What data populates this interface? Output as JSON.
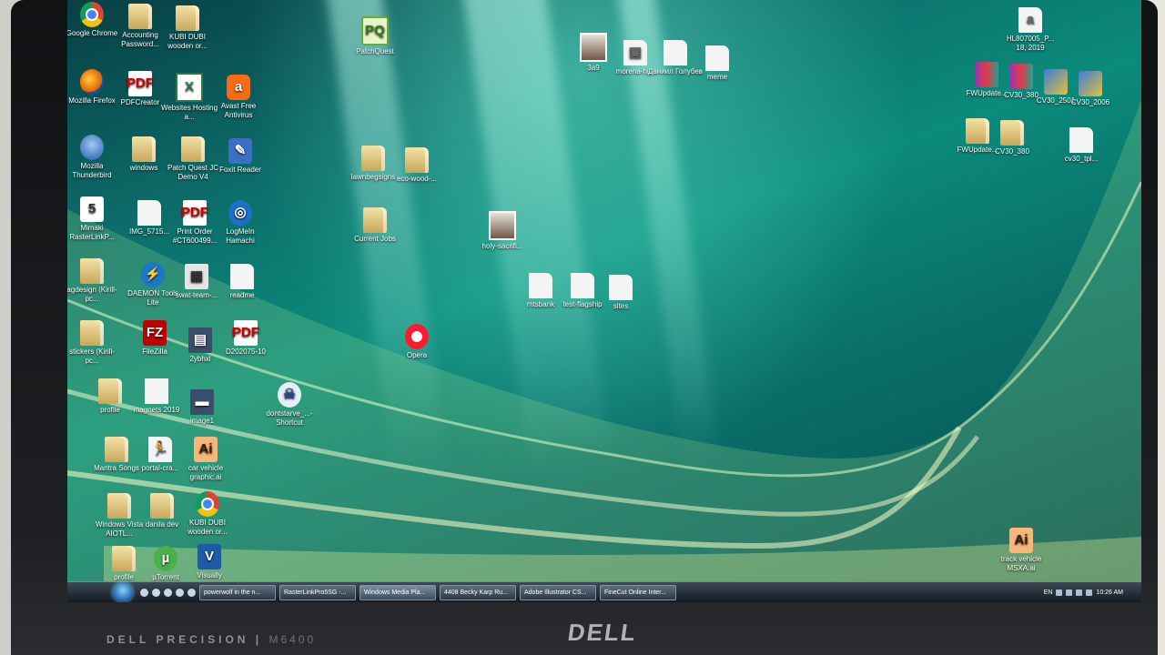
{
  "device": {
    "brand_left": "DELL PRECISION",
    "model": "M6400",
    "logo": "DELL"
  },
  "desktop": {
    "icons": [
      {
        "label": "Google Chrome",
        "icon": "chrome-icon"
      },
      {
        "label": "Accounting Password...",
        "icon": "folder-icon"
      },
      {
        "label": "KUBI DUBI wooden or...",
        "icon": "folder-icon"
      },
      {
        "label": "Mozilla Firefox",
        "icon": "firefox-icon"
      },
      {
        "label": "PDFCreator",
        "icon": "pdf-icon"
      },
      {
        "label": "Websites Hosting a...",
        "icon": "excel-icon"
      },
      {
        "label": "Avast Free Antivirus",
        "icon": "avast-icon"
      },
      {
        "label": "Mozilla Thunderbird",
        "icon": "thunderbird-icon"
      },
      {
        "label": "windows",
        "icon": "folder-icon"
      },
      {
        "label": "Patch Quest JC Demo V4",
        "icon": "folder-icon"
      },
      {
        "label": "Foxit Reader",
        "icon": "foxit-icon"
      },
      {
        "label": "Mimaki RasterLinkP...",
        "icon": "mimaki-icon"
      },
      {
        "label": "IMG_5715...",
        "icon": "document-icon"
      },
      {
        "label": "Print Order #CT600499...",
        "icon": "pdf-icon"
      },
      {
        "label": "LogMeIn Hamachi",
        "icon": "hamachi-icon"
      },
      {
        "label": "agdesign (Kirill-pc...",
        "icon": "folder-icon"
      },
      {
        "label": "DAEMON Tools Lite",
        "icon": "daemon-icon"
      },
      {
        "label": "swat-team-...",
        "icon": "image-icon"
      },
      {
        "label": "readme",
        "icon": "document-icon"
      },
      {
        "label": "stickers (Kirill-pc...",
        "icon": "folder-icon"
      },
      {
        "label": "FileZilla",
        "icon": "filezilla-icon"
      },
      {
        "label": "2ybhxl",
        "icon": "image-icon"
      },
      {
        "label": "D202075-10",
        "icon": "pdf-icon"
      },
      {
        "label": "profile",
        "icon": "folder-icon"
      },
      {
        "label": "magnets 2019",
        "icon": "document-icon"
      },
      {
        "label": "image1",
        "icon": "image-icon"
      },
      {
        "label": "Mantra Songs",
        "icon": "folder-icon"
      },
      {
        "label": "portal-cra...",
        "icon": "image-icon"
      },
      {
        "label": "car vehicle graphic.ai",
        "icon": "illustrator-icon"
      },
      {
        "label": "Windows Vista AIOTL...",
        "icon": "folder-icon"
      },
      {
        "label": "danila dev",
        "icon": "folder-icon"
      },
      {
        "label": "KUBI DUBI wooden or...",
        "icon": "chrome-icon"
      },
      {
        "label": "profile",
        "icon": "folder-icon"
      },
      {
        "label": "µTorrent",
        "icon": "utorrent-icon"
      },
      {
        "label": "Visually",
        "icon": "visual-studio-icon"
      },
      {
        "label": "PatchQuest",
        "icon": "patchquest-icon"
      },
      {
        "label": "lawnbegsigns",
        "icon": "folder-icon"
      },
      {
        "label": "eco-wood-...",
        "icon": "folder-icon"
      },
      {
        "label": "Current Jobs",
        "icon": "folder-icon"
      },
      {
        "label": "holy-sacrifi...",
        "icon": "image-icon"
      },
      {
        "label": "Opera",
        "icon": "opera-icon"
      },
      {
        "label": "dontstarve_...- Shortcut",
        "icon": "dontstarve-icon"
      },
      {
        "label": "3a9",
        "icon": "photo-icon"
      },
      {
        "label": "morena-hi...",
        "icon": "image-icon"
      },
      {
        "label": "Даниил Голубев",
        "icon": "document-icon"
      },
      {
        "label": "meme",
        "icon": "document-icon"
      },
      {
        "label": "mtsbank",
        "icon": "document-icon"
      },
      {
        "label": "test-flagship",
        "icon": "document-icon"
      },
      {
        "label": "sites",
        "icon": "document-icon"
      },
      {
        "label": "HL807005_P... 18, 2019",
        "icon": "document-icon"
      },
      {
        "label": "FWUpdate...",
        "icon": "winrar-icon"
      },
      {
        "label": "CV30_380",
        "icon": "winrar-icon"
      },
      {
        "label": "CV30_2501",
        "icon": "setup-icon"
      },
      {
        "label": "CV30_2006",
        "icon": "setup-icon"
      },
      {
        "label": "FWUpdate...",
        "icon": "folder-icon"
      },
      {
        "label": "CV30_380",
        "icon": "folder-icon"
      },
      {
        "label": "cv30_tpl...",
        "icon": "document-icon"
      },
      {
        "label": "track vehicle MSXA.ai",
        "icon": "illustrator-icon"
      }
    ]
  },
  "taskbar": {
    "tasks": [
      {
        "label": "powerwolf in the n..."
      },
      {
        "label": "RasterLinkPro5SG -..."
      },
      {
        "label": "Windows Media Pla..."
      },
      {
        "label": "4408 Becky Karp Ru..."
      },
      {
        "label": "Adobe Illustrator CS..."
      },
      {
        "label": "FineCut Online Inter..."
      }
    ],
    "tray_lang": "EN",
    "clock": "10:26 AM"
  }
}
